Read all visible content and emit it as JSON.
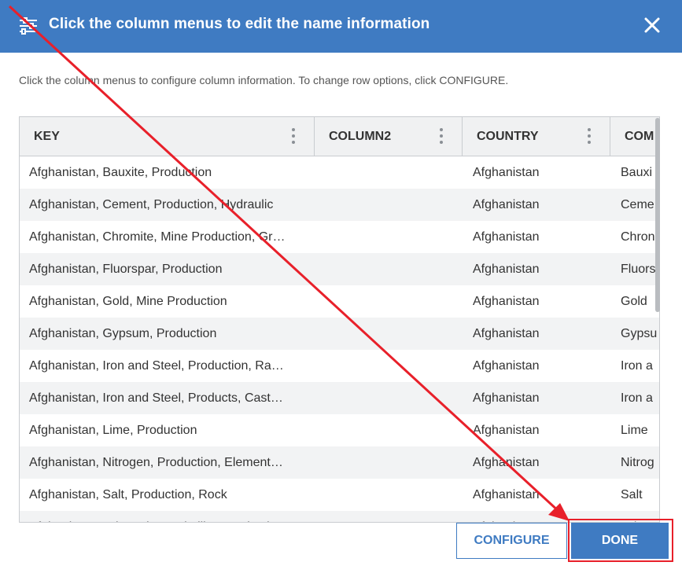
{
  "dialog": {
    "title": "Click the column menus to edit the name information",
    "instructions": "Click the column menus to configure column information. To change row options, click CONFIGURE.",
    "accent_color": "#3f7bc2"
  },
  "grid": {
    "columns": [
      "KEY",
      "COLUMN2",
      "COUNTRY",
      "COM"
    ],
    "rows": [
      {
        "key": "Afghanistan, Bauxite, Production",
        "column2": "",
        "country": "Afghanistan",
        "com": "Bauxi"
      },
      {
        "key": "Afghanistan, Cement, Production, Hydraulic",
        "column2": "",
        "country": "Afghanistan",
        "com": "Ceme"
      },
      {
        "key": "Afghanistan, Chromite, Mine Production, Gr…",
        "column2": "",
        "country": "Afghanistan",
        "com": "Chron"
      },
      {
        "key": "Afghanistan, Fluorspar, Production",
        "column2": "",
        "country": "Afghanistan",
        "com": "Fluors"
      },
      {
        "key": "Afghanistan, Gold, Mine Production",
        "column2": "",
        "country": "Afghanistan",
        "com": "Gold"
      },
      {
        "key": "Afghanistan, Gypsum, Production",
        "column2": "",
        "country": "Afghanistan",
        "com": "Gypsu"
      },
      {
        "key": "Afghanistan, Iron and Steel, Production, Ra…",
        "column2": "",
        "country": "Afghanistan",
        "com": "Iron a"
      },
      {
        "key": "Afghanistan, Iron and Steel, Products, Cast…",
        "column2": "",
        "country": "Afghanistan",
        "com": "Iron a"
      },
      {
        "key": "Afghanistan, Lime, Production",
        "column2": "",
        "country": "Afghanistan",
        "com": "Lime"
      },
      {
        "key": "Afghanistan, Nitrogen, Production, Element…",
        "column2": "",
        "country": "Afghanistan",
        "com": "Nitrog"
      },
      {
        "key": "Afghanistan, Salt, Production, Rock",
        "column2": "",
        "country": "Afghanistan",
        "com": "Salt"
      },
      {
        "key": "Afghanistan, Talc and pyrophyllite, Production",
        "column2": "",
        "country": "Afghanistan",
        "com": "Talc"
      }
    ]
  },
  "buttons": {
    "configure": "CONFIGURE",
    "done": "DONE"
  },
  "annotation": {
    "color": "#e8202a"
  }
}
